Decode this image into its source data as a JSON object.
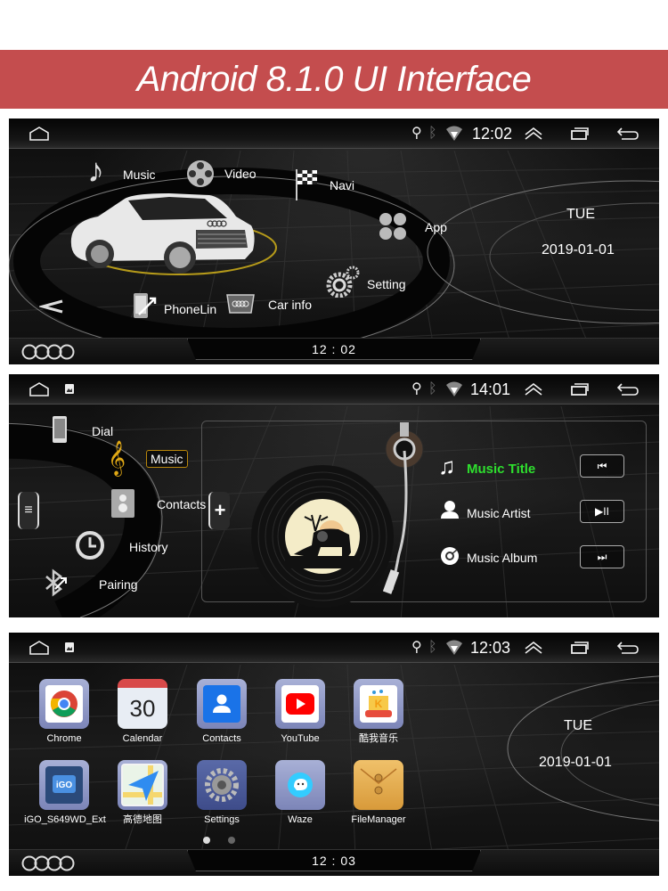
{
  "banner": {
    "title": "Android 8.1.0 UI Interface"
  },
  "screens": [
    {
      "status": {
        "time": "12:02",
        "icons": [
          "home-icon",
          "usb-icon",
          "bluetooth-icon",
          "wifi-icon",
          "expand-icon",
          "recents-icon",
          "back-icon"
        ]
      },
      "menu": {
        "music": "Music",
        "video": "Video",
        "navi": "Navi",
        "app": "App",
        "setting": "Setting",
        "car_info": "Car info",
        "phonelink": "PhoneLink"
      },
      "date": {
        "day": "TUE",
        "date": "2019-01-01"
      },
      "bottom_clock": "12 : 02"
    },
    {
      "status": {
        "time": "14:01"
      },
      "phone_menu": {
        "dial": "Dial",
        "music": "Music",
        "contacts": "Contacts",
        "history": "History",
        "pairing": "Pairing"
      },
      "player": {
        "title": "Music Title",
        "artist": "Music Artist",
        "album": "Music Album",
        "prev_label": "⏮",
        "play_pause_label": "▶II",
        "next_label": "⏭",
        "title_color": "#2ee02e"
      }
    },
    {
      "status": {
        "time": "12:03"
      },
      "apps": [
        {
          "label": "Chrome"
        },
        {
          "label": "Calendar",
          "badge": "30"
        },
        {
          "label": "Contacts"
        },
        {
          "label": "YouTube"
        },
        {
          "label": "酷我音乐"
        },
        {
          "label": "iGO_S649WD_Ext"
        },
        {
          "label": "高德地图"
        },
        {
          "label": "Settings"
        },
        {
          "label": "Waze"
        },
        {
          "label": "FileManager"
        }
      ],
      "page_indicator": {
        "current": 1,
        "total": 2
      },
      "date": {
        "day": "TUE",
        "date": "2019-01-01"
      },
      "bottom_clock": "12 : 03"
    }
  ]
}
